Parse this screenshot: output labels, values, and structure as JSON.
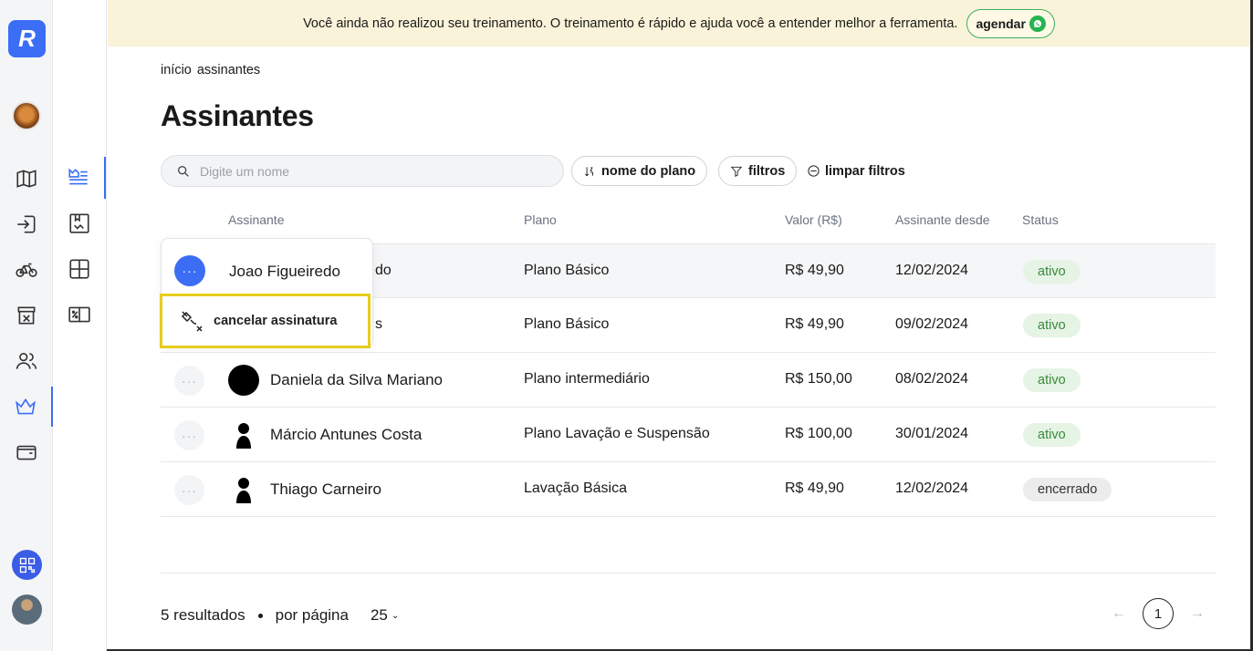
{
  "brand": {
    "logo_letter": "R",
    "accent": "#3b6ef5"
  },
  "banner": {
    "text": "Você ainda não realizou seu treinamento. O treinamento é rápido e ajuda você a entender melhor a ferramenta.",
    "button_label": "agendar"
  },
  "breadcrumb": {
    "home": "início",
    "current": "assinantes"
  },
  "page_title": "Assinantes",
  "search": {
    "placeholder": "Digite um nome"
  },
  "filters": {
    "sort_label": "nome do plano",
    "filters_label": "filtros",
    "clear_label": "limpar filtros"
  },
  "table": {
    "headers": {
      "subscriber": "Assinante",
      "plan": "Plano",
      "value": "Valor (R$)",
      "since": "Assinante desde",
      "status": "Status"
    },
    "rows": [
      {
        "name": "Joao Figueiredo",
        "name_suffix": "do",
        "plan": "Plano Básico",
        "value": "R$ 49,90",
        "since": "12/02/2024",
        "status": "ativo"
      },
      {
        "name_suffix": "s",
        "plan": "Plano Básico",
        "value": "R$ 49,90",
        "since": "09/02/2024",
        "status": "ativo"
      },
      {
        "name": "Daniela da Silva Mariano",
        "plan": "Plano intermediário",
        "value": "R$ 150,00",
        "since": "08/02/2024",
        "status": "ativo"
      },
      {
        "name": "Márcio Antunes Costa",
        "plan": "Plano Lavação e Suspensão",
        "value": "R$ 100,00",
        "since": "30/01/2024",
        "status": "ativo"
      },
      {
        "name": "Thiago Carneiro",
        "plan": "Lavação Básica",
        "value": "R$ 49,90",
        "since": "12/02/2024",
        "status": "encerrado"
      }
    ]
  },
  "row_menu": {
    "more_label": "···",
    "subscriber_name": "Joao Figueiredo",
    "cancel_label": "cancelar assinatura"
  },
  "footer": {
    "results": "5 resultados",
    "per_page_label": "por página",
    "per_page_value": "25",
    "current_page": "1"
  },
  "icons": {
    "rail": [
      "map-icon",
      "login-icon",
      "bike-icon",
      "store-icon",
      "users-icon",
      "crown-icon",
      "wallet-icon"
    ],
    "subrail": [
      "crown-list-icon",
      "bookmark-box-icon",
      "grid-icon",
      "percent-tag-icon"
    ]
  }
}
